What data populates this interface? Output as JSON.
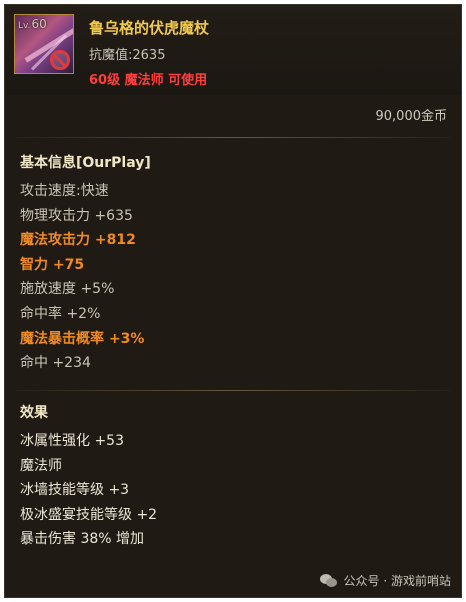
{
  "item": {
    "level_badge_prefix": "Lv.",
    "level_badge_value": "60",
    "icon": "staff-icon",
    "status_icon": "forbidden-icon",
    "name": "鲁乌格的伏虎魔杖",
    "resist_label": "抗魔值:2635",
    "requirement": "60级 魔法师 可使用",
    "price": "90,000金币"
  },
  "basic_info": {
    "title": "基本信息[OurPlay]",
    "rows": [
      {
        "text": "攻击速度:快速",
        "style": "normal"
      },
      {
        "text": "物理攻击力 +635",
        "style": "normal"
      },
      {
        "text": "魔法攻击力 +812",
        "style": "orange"
      },
      {
        "text": "智力 +75",
        "style": "orange"
      },
      {
        "text": "施放速度 +5%",
        "style": "normal"
      },
      {
        "text": "命中率 +2%",
        "style": "normal"
      },
      {
        "text": "魔法暴击概率 +3%",
        "style": "orange"
      },
      {
        "text": "命中 +234",
        "style": "normal"
      }
    ]
  },
  "effects": {
    "title": "效果",
    "rows": [
      {
        "text": "冰属性强化 +53",
        "style": "white"
      },
      {
        "text": "魔法师",
        "style": "white"
      },
      {
        "text": "冰墙技能等级 +3",
        "style": "white"
      },
      {
        "text": "极冰盛宴技能等级 +2",
        "style": "white"
      },
      {
        "text": "暴击伤害 38% 增加",
        "style": "white"
      }
    ]
  },
  "watermark": {
    "icon": "wechat-icon",
    "text": "公众号 · 游戏前哨站"
  },
  "colors": {
    "name_gold": "#f1c94c",
    "requirement_red": "#ff3f3f",
    "highlight_orange": "#f08a22",
    "background": "#1f1a14"
  }
}
